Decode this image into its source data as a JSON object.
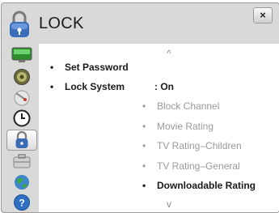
{
  "header": {
    "title": "LOCK",
    "close_label": "×"
  },
  "sidebar": {
    "items": [
      {
        "icon": "picture-icon"
      },
      {
        "icon": "sound-icon"
      },
      {
        "icon": "channel-icon"
      },
      {
        "icon": "time-icon"
      },
      {
        "icon": "lock-icon",
        "active": true
      },
      {
        "icon": "option-icon"
      },
      {
        "icon": "network-icon"
      },
      {
        "icon": "support-icon"
      }
    ]
  },
  "content": {
    "scroll_up": "^",
    "scroll_down": "v",
    "main_items": [
      {
        "label": "Set Password",
        "value": ""
      },
      {
        "label": "Lock System",
        "value": ": On"
      }
    ],
    "sub_items": [
      {
        "label": "Block Channel"
      },
      {
        "label": "Movie Rating"
      },
      {
        "label": "TV Rating–Children"
      },
      {
        "label": "TV Rating–General"
      },
      {
        "label": "Downloadable Rating",
        "highlighted": true
      }
    ]
  },
  "colors": {
    "panel_bg": "#d9d9d9",
    "content_bg": "#ffffff",
    "disabled_text": "#9a9a9a",
    "text": "#1a1a1a"
  }
}
